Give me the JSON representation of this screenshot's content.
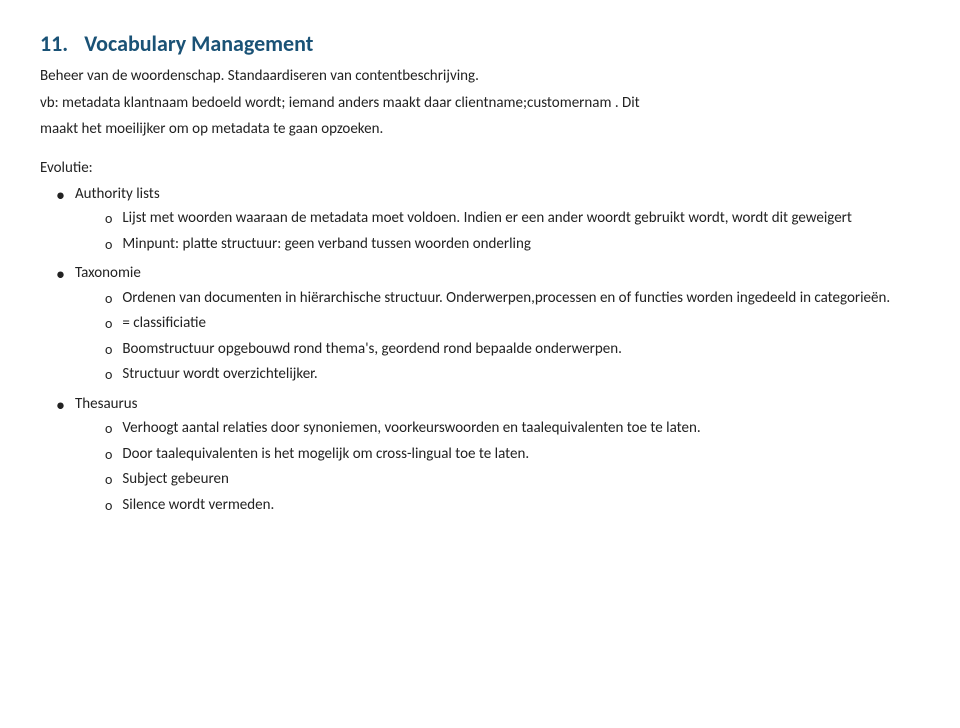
{
  "page": {
    "title_number": "11.",
    "title_text": "Vocabulary Management",
    "intro_lines": [
      "Beheer van de woordenschap. Standaardiseren van contentbeschrijving.",
      "vb: metadata klantnaam bedoeld wordt; iemand anders maakt daar clientname;customernam . Dit",
      "maakt het moeilijker om op metadata te gaan opzoeken."
    ],
    "evolutie_label": "Evolutie:",
    "bullet_items": [
      {
        "label": "Authority lists",
        "sub_items": [
          {
            "text": "Lijst met woorden waaraan de metadata moet voldoen. Indien er een ander woordt gebruikt wordt, wordt dit geweigert"
          },
          {
            "text": "Minpunt: platte structuur: geen verband tussen woorden onderling"
          }
        ]
      },
      {
        "label": "Taxonomie",
        "sub_items": [
          {
            "text": "Ordenen van documenten in hiërarchische structuur. Onderwerpen,processen en of functies worden ingedeeld in categorieën."
          },
          {
            "text": "= classificiatie"
          },
          {
            "text": "Boomstructuur opgebouwd rond thema's, geordend rond bepaalde onderwerpen."
          },
          {
            "text": "Structuur wordt overzichtelijker."
          }
        ]
      },
      {
        "label": "Thesaurus",
        "sub_items": [
          {
            "text": "Verhoogt aantal relaties door synoniemen, voorkeurswoorden en taalequivalenten toe te laten."
          },
          {
            "text": "Door taalequivalenten is het mogelijk om cross-lingual toe te laten."
          },
          {
            "text": "Subject gebeuren"
          },
          {
            "text": "Silence wordt vermeden."
          }
        ]
      }
    ]
  }
}
